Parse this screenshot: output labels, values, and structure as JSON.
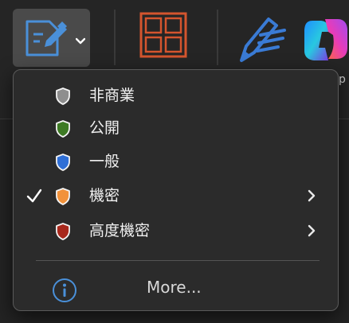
{
  "toolbar": {
    "partial_text": "p"
  },
  "menu": {
    "items": [
      {
        "label": "非商業",
        "shield_color": "#8e8e8e",
        "checked": false,
        "has_submenu": false
      },
      {
        "label": "公開",
        "shield_color": "#3d7a24",
        "checked": false,
        "has_submenu": false
      },
      {
        "label": "一般",
        "shield_color": "#2f6fd6",
        "checked": false,
        "has_submenu": false
      },
      {
        "label": "機密",
        "shield_color": "#f2923a",
        "checked": true,
        "has_submenu": true
      },
      {
        "label": "高度機密",
        "shield_color": "#a8281c",
        "checked": false,
        "has_submenu": true
      }
    ],
    "more_label": "More..."
  },
  "icons": {
    "toolbar_button": "sensitivity-document-icon",
    "dropdown": "chevron-down-icon",
    "grid": "grid-layout-icon",
    "pen": "pen-icon",
    "copilot": "copilot-icon",
    "check": "checkmark-icon",
    "shield": "shield-icon",
    "submenu": "chevron-right-icon",
    "info": "info-icon"
  },
  "colors": {
    "accent_blue": "#4a90d9",
    "grid_orange": "#d4552e"
  }
}
